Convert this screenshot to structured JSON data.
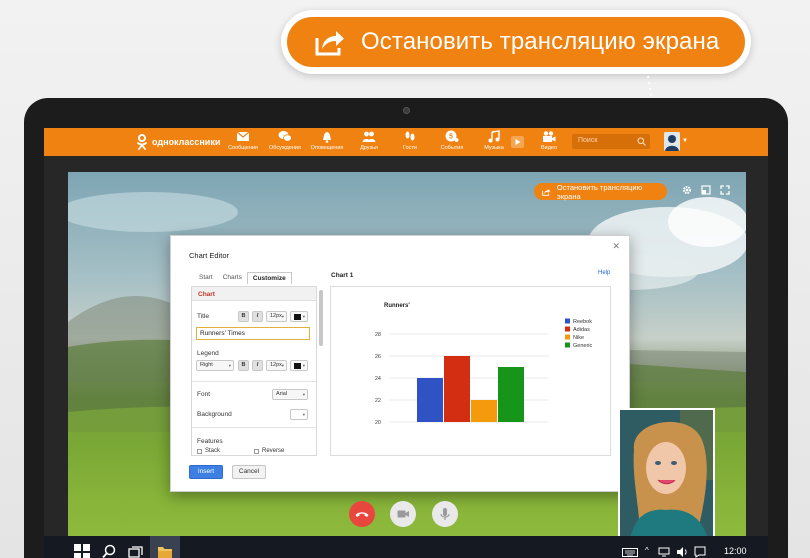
{
  "callout": {
    "label": "Остановить трансляцию экрана",
    "icon": "share-screen-icon"
  },
  "ok_header": {
    "brand": "одноклассники",
    "nav": [
      {
        "label": "Сообщения",
        "icon": "envelope-icon"
      },
      {
        "label": "Обсуждения",
        "icon": "chat-bubbles-icon"
      },
      {
        "label": "Оповещения",
        "icon": "bell-icon"
      },
      {
        "label": "Друзья",
        "icon": "friends-icon"
      },
      {
        "label": "Гости",
        "icon": "footprints-icon"
      },
      {
        "label": "События",
        "icon": "events-icon"
      },
      {
        "label": "Музыка",
        "icon": "music-note-icon"
      },
      {
        "label": "Видео",
        "icon": "video-camera-icon"
      }
    ],
    "search_placeholder": "Поиск",
    "colors": {
      "accent": "#ef8211"
    }
  },
  "shared_screen": {
    "stop_button_label": "Остановить трансляцию экрана",
    "chart_editor": {
      "window_title": "Chart Editor",
      "tabs": [
        "Start",
        "Charts",
        "Customize"
      ],
      "active_tab": "Customize",
      "section": "Chart",
      "title_label": "Title",
      "title_value": "Runners' Times",
      "font_size": "12px",
      "legend_label": "Legend",
      "legend_position": "Right",
      "legend_font_size": "12px",
      "font_label": "Font",
      "font_value": "Arial",
      "background_label": "Background",
      "features_label": "Features",
      "feature_options": [
        "Stack",
        "Reverse"
      ],
      "bold_label": "B",
      "italic_label": "I",
      "chart_label": "Chart 1",
      "help_label": "Help",
      "insert_label": "Insert",
      "cancel_label": "Cancel"
    },
    "taskbar": {
      "clock": "12:00"
    }
  },
  "chart_data": {
    "type": "bar",
    "title": "Runners'",
    "xlabel": "",
    "ylabel": "",
    "ylim": [
      20,
      29
    ],
    "yticks": [
      20,
      22,
      24,
      26,
      28
    ],
    "grid": true,
    "legend_position": "right",
    "series": [
      {
        "name": "Reebok",
        "values": [
          24
        ],
        "color": "#2f52c4"
      },
      {
        "name": "Adidas",
        "values": [
          26
        ],
        "color": "#d32e12"
      },
      {
        "name": "Nike",
        "values": [
          22
        ],
        "color": "#f59a0c"
      },
      {
        "name": "Generic",
        "values": [
          25
        ],
        "color": "#17941a"
      }
    ]
  }
}
